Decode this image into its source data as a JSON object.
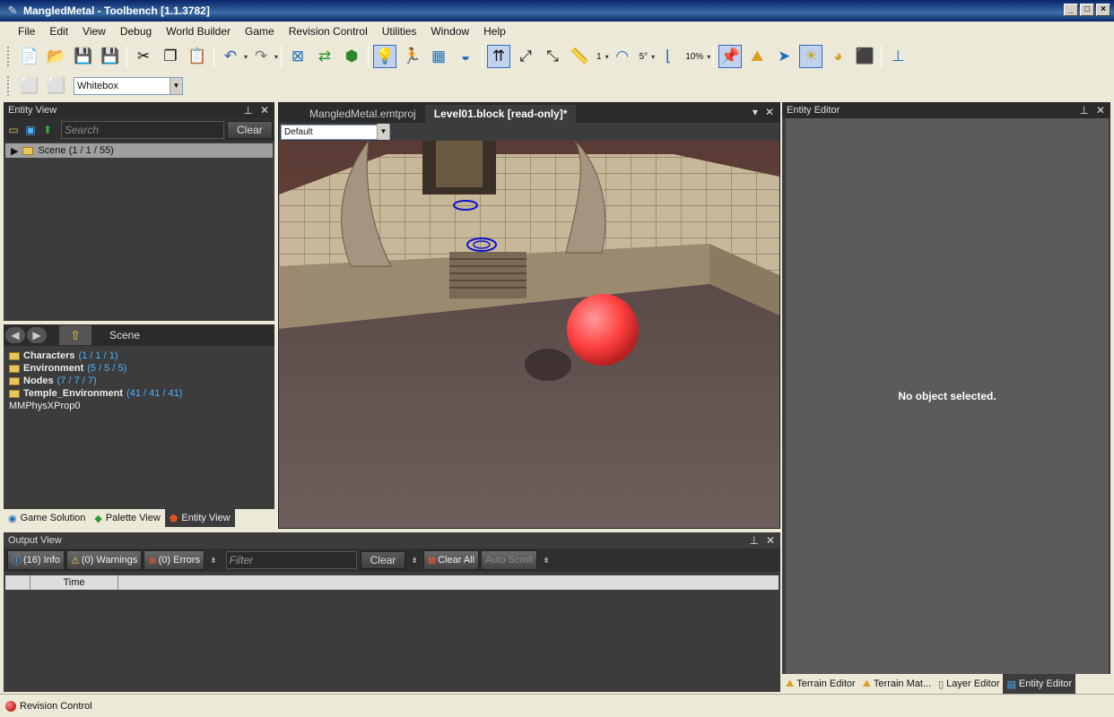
{
  "window": {
    "title": "MangledMetal - Toolbench [1.1.3782]"
  },
  "menu": [
    "File",
    "Edit",
    "View",
    "Debug",
    "World Builder",
    "Game",
    "Revision Control",
    "Utilities",
    "Window",
    "Help"
  ],
  "toolbar": {
    "grid_value": "1",
    "angle_value": "5°",
    "scale_value": "10%",
    "mode_combo": "Whitebox"
  },
  "entity_view": {
    "title": "Entity View",
    "search_placeholder": "Search",
    "clear_label": "Clear",
    "scene_row": "Scene (1 / 1 / 55)",
    "nav_label": "Scene",
    "items": [
      {
        "name": "Characters",
        "count": "(1 / 1 / 1)"
      },
      {
        "name": "Environment",
        "count": "(5 / 5 / 5)"
      },
      {
        "name": "Nodes",
        "count": "(7 / 7 / 7)"
      },
      {
        "name": "Temple_Environment",
        "count": "(41 / 41 / 41)"
      }
    ],
    "leaf_item": "MMPhysXProp0"
  },
  "left_tabs": [
    "Game Solution",
    "Palette View",
    "Entity View"
  ],
  "document": {
    "tabs": [
      "MangledMetal.emtproj",
      "Level01.block [read-only]*"
    ],
    "view_combo": "Default"
  },
  "entity_editor": {
    "title": "Entity Editor",
    "empty_text": "No object selected."
  },
  "right_tabs": [
    "Terrain Editor",
    "Terrain Mat...",
    "Layer Editor",
    "Entity Editor"
  ],
  "output": {
    "title": "Output View",
    "info": "(16) Info",
    "warnings": "(0) Warnings",
    "errors": "(0) Errors",
    "filter_placeholder": "Filter",
    "clear_label": "Clear",
    "clear_all": "Clear All",
    "auto_scroll": "Auto Scroll",
    "col_time": "Time"
  },
  "status": {
    "label": "Revision Control"
  },
  "colors": {
    "sphere": "#ff4040",
    "panel_bg": "#3c3c3c",
    "accent_blue": "#4db3ff"
  }
}
